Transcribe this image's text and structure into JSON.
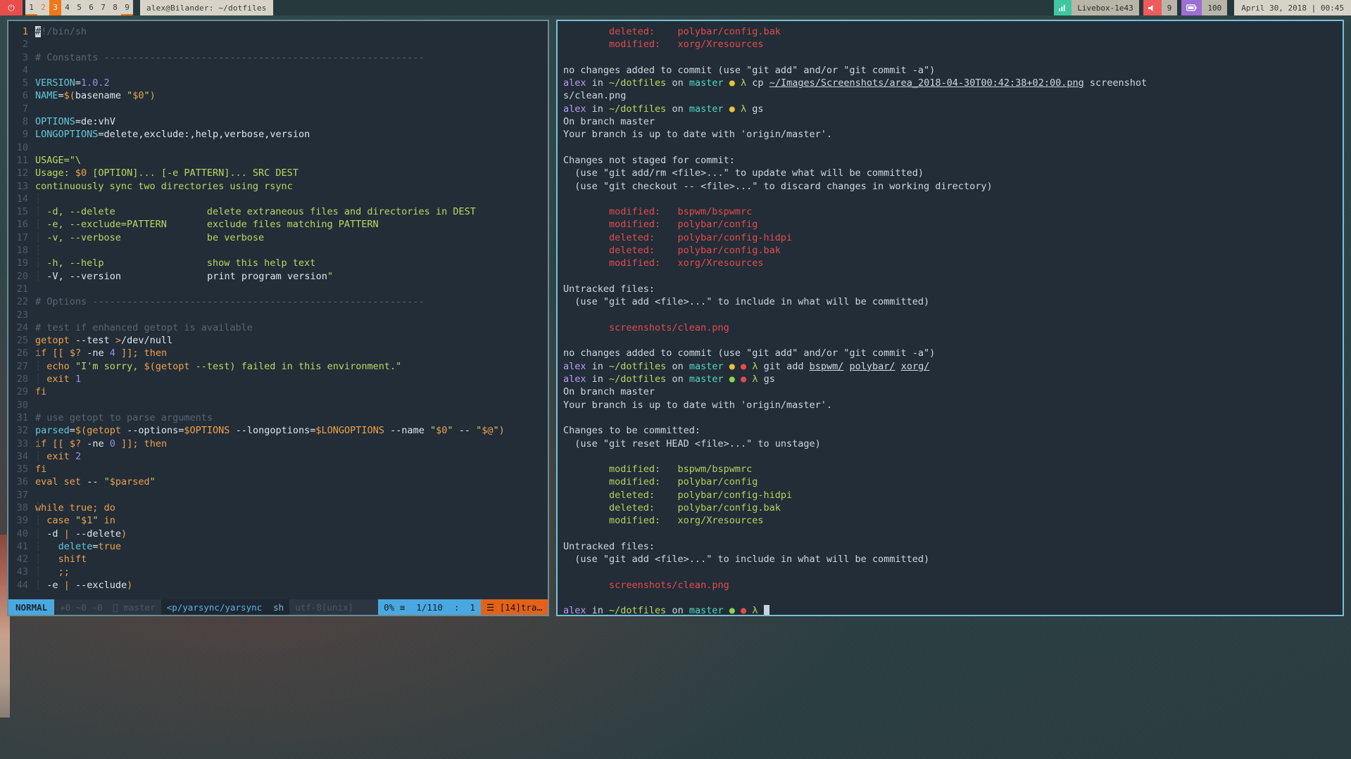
{
  "bar": {
    "power_icon": "⏻",
    "workspaces": [
      {
        "label": "1",
        "state": "occupied-underline"
      },
      {
        "label": "2",
        "state": "occupied"
      },
      {
        "label": "3",
        "state": "focused"
      },
      {
        "label": "4",
        "state": "empty"
      },
      {
        "label": "5",
        "state": "empty"
      },
      {
        "label": "6",
        "state": "empty"
      },
      {
        "label": "7",
        "state": "empty"
      },
      {
        "label": "8",
        "state": "empty"
      },
      {
        "label": "9",
        "state": "occupied-underline"
      }
    ],
    "window_title": "alex@Bilander: ~/dotfiles",
    "modules": [
      {
        "name": "network",
        "icon": "▁▄█",
        "value": "Livebox-1e43",
        "color": "#3ec7a0"
      },
      {
        "name": "volume",
        "icon": "🔊",
        "value": "9",
        "color": "#ef5b5b"
      },
      {
        "name": "battery",
        "icon": "▭",
        "value": "100",
        "color": "#9b6fd4"
      }
    ],
    "datetime": "April 30, 2018 | 00:45"
  },
  "vim": {
    "lines": [
      {
        "n": "1",
        "cur": true
      },
      {
        "n": "2"
      },
      {
        "n": "3"
      },
      {
        "n": "4"
      },
      {
        "n": "5"
      },
      {
        "n": "6"
      },
      {
        "n": "7"
      },
      {
        "n": "8"
      },
      {
        "n": "9"
      },
      {
        "n": "10"
      },
      {
        "n": "11"
      },
      {
        "n": "12"
      },
      {
        "n": "13"
      },
      {
        "n": "14"
      },
      {
        "n": "15"
      },
      {
        "n": "16"
      },
      {
        "n": "17"
      },
      {
        "n": "18"
      },
      {
        "n": "19"
      },
      {
        "n": "20"
      },
      {
        "n": "21"
      },
      {
        "n": "22"
      },
      {
        "n": "23"
      },
      {
        "n": "24"
      },
      {
        "n": "25"
      },
      {
        "n": "26"
      },
      {
        "n": "27"
      },
      {
        "n": "28"
      },
      {
        "n": "29"
      },
      {
        "n": "30"
      },
      {
        "n": "31"
      },
      {
        "n": "32"
      },
      {
        "n": "33"
      },
      {
        "n": "34"
      },
      {
        "n": "35"
      },
      {
        "n": "36"
      },
      {
        "n": "37"
      },
      {
        "n": "38"
      },
      {
        "n": "39"
      },
      {
        "n": "40"
      },
      {
        "n": "41"
      },
      {
        "n": "42"
      },
      {
        "n": "43"
      }
    ],
    "source_text": [
      "#!/bin/sh",
      "",
      "# Constants --------------------------------------------------------",
      "",
      "VERSION=1.0.2",
      "NAME=$(basename \"$0\")",
      "",
      "OPTIONS=de:vhV",
      "LONGOPTIONS=delete,exclude:,help,verbose,version",
      "",
      "USAGE=\"\\",
      "Usage: $0 [OPTION]... [-e PATTERN]... SRC DEST",
      "continuously sync two directories using rsync",
      "",
      "  -d, --delete                delete extraneous files and directories in DEST",
      "  -e, --exclude=PATTERN       exclude files matching PATTERN",
      "  -v, --verbose               be verbose",
      "",
      "  -h, --help                  show this help text",
      "  -V, --version               print program version\"",
      "",
      "# Options ----------------------------------------------------------",
      "",
      "# test if enhanced getopt is available",
      "getopt --test >/dev/null",
      "if [[ $? -ne 4 ]]; then",
      "  echo \"I'm sorry, $(getopt --test) failed in this environment.\"",
      "  exit 1",
      "fi",
      "",
      "# use getopt to parse arguments",
      "parsed=$(getopt --options=$OPTIONS --longoptions=$LONGOPTIONS --name \"$0\" -- \"$@\")",
      "if [[ $? -ne 0 ]]; then",
      "  exit 2",
      "fi",
      "eval set -- \"$parsed\"",
      "",
      "while true; do",
      "  case \"$1\" in",
      "  -d | --delete)",
      "    delete=true",
      "    shift",
      "    ;;",
      "  -e | --exclude)"
    ],
    "status": {
      "mode": "NORMAL",
      "git_added": "+0",
      "git_modified": "~0",
      "git_removed": "-0",
      "branch_icon": "",
      "branch": "master",
      "file": "<p/yarsync/yarsync",
      "filetype": "sh",
      "encoding": "utf-8[unix]",
      "percent": "0%",
      "percent_icon": "≡",
      "line_total": "1/110",
      "line_icon": "",
      "col_sep": ":",
      "col": "1",
      "tag_icon": "☰",
      "tag": "[14]tra…"
    }
  },
  "terminal": {
    "lines": [
      {
        "id": 0,
        "segments": [
          {
            "t": "        deleted:    polybar/config.bak",
            "c": "t-red"
          }
        ]
      },
      {
        "id": 1,
        "segments": [
          {
            "t": "        modified:   xorg/Xresources",
            "c": "t-red"
          }
        ]
      },
      {
        "id": 2,
        "segments": [
          {
            "t": "",
            "c": "t-grey"
          }
        ]
      },
      {
        "id": 3,
        "segments": [
          {
            "t": "no changes added to commit (use \"git add\" and/or \"git commit -a\")",
            "c": "t-grey"
          }
        ]
      },
      {
        "id": 4,
        "segments": [
          {
            "t": "alex",
            "c": "t-user"
          },
          {
            "t": " in ",
            "c": "t-grey"
          },
          {
            "t": "~/dotfiles",
            "c": "t-path"
          },
          {
            "t": " on ",
            "c": "t-grey"
          },
          {
            "t": "master",
            "c": "t-branch"
          },
          {
            "t": " ",
            "c": "t-grey"
          },
          {
            "t": "●",
            "c": "dot-y"
          },
          {
            "t": " ",
            "c": "t-grey"
          },
          {
            "t": "λ",
            "c": "t-lambda"
          },
          {
            "t": " cp ",
            "c": "t-cmd"
          },
          {
            "t": "~/Images/Screenshots/area_2018-04-30T00:42:38+02:00.png",
            "c": "t-grey t-ul"
          },
          {
            "t": " screenshot",
            "c": "t-grey"
          }
        ]
      },
      {
        "id": 5,
        "segments": [
          {
            "t": "s/clean.png",
            "c": "t-grey"
          }
        ]
      },
      {
        "id": 6,
        "segments": [
          {
            "t": "alex",
            "c": "t-user"
          },
          {
            "t": " in ",
            "c": "t-grey"
          },
          {
            "t": "~/dotfiles",
            "c": "t-path"
          },
          {
            "t": " on ",
            "c": "t-grey"
          },
          {
            "t": "master",
            "c": "t-branch"
          },
          {
            "t": " ",
            "c": "t-grey"
          },
          {
            "t": "●",
            "c": "dot-y"
          },
          {
            "t": " ",
            "c": "t-grey"
          },
          {
            "t": "λ",
            "c": "t-lambda"
          },
          {
            "t": " gs",
            "c": "t-cmd"
          }
        ]
      },
      {
        "id": 7,
        "segments": [
          {
            "t": "On branch master",
            "c": "t-grey"
          }
        ]
      },
      {
        "id": 8,
        "segments": [
          {
            "t": "Your branch is up to date with 'origin/master'.",
            "c": "t-grey"
          }
        ]
      },
      {
        "id": 9,
        "segments": [
          {
            "t": "",
            "c": "t-grey"
          }
        ]
      },
      {
        "id": 10,
        "segments": [
          {
            "t": "Changes not staged for commit:",
            "c": "t-grey"
          }
        ]
      },
      {
        "id": 11,
        "segments": [
          {
            "t": "  (use \"git add/rm <file>...\" to update what will be committed)",
            "c": "t-grey"
          }
        ]
      },
      {
        "id": 12,
        "segments": [
          {
            "t": "  (use \"git checkout -- <file>...\" to discard changes in working directory)",
            "c": "t-grey"
          }
        ]
      },
      {
        "id": 13,
        "segments": [
          {
            "t": "",
            "c": "t-grey"
          }
        ]
      },
      {
        "id": 14,
        "segments": [
          {
            "t": "        modified:   bspwm/bspwmrc",
            "c": "t-red"
          }
        ]
      },
      {
        "id": 15,
        "segments": [
          {
            "t": "        modified:   polybar/config",
            "c": "t-red"
          }
        ]
      },
      {
        "id": 16,
        "segments": [
          {
            "t": "        deleted:    polybar/config-hidpi",
            "c": "t-red"
          }
        ]
      },
      {
        "id": 17,
        "segments": [
          {
            "t": "        deleted:    polybar/config.bak",
            "c": "t-red"
          }
        ]
      },
      {
        "id": 18,
        "segments": [
          {
            "t": "        modified:   xorg/Xresources",
            "c": "t-red"
          }
        ]
      },
      {
        "id": 19,
        "segments": [
          {
            "t": "",
            "c": "t-grey"
          }
        ]
      },
      {
        "id": 20,
        "segments": [
          {
            "t": "Untracked files:",
            "c": "t-grey"
          }
        ]
      },
      {
        "id": 21,
        "segments": [
          {
            "t": "  (use \"git add <file>...\" to include in what will be committed)",
            "c": "t-grey"
          }
        ]
      },
      {
        "id": 22,
        "segments": [
          {
            "t": "",
            "c": "t-grey"
          }
        ]
      },
      {
        "id": 23,
        "segments": [
          {
            "t": "        screenshots/clean.png",
            "c": "t-red"
          }
        ]
      },
      {
        "id": 24,
        "segments": [
          {
            "t": "",
            "c": "t-grey"
          }
        ]
      },
      {
        "id": 25,
        "segments": [
          {
            "t": "no changes added to commit (use \"git add\" and/or \"git commit -a\")",
            "c": "t-grey"
          }
        ]
      },
      {
        "id": 26,
        "segments": [
          {
            "t": "alex",
            "c": "t-user"
          },
          {
            "t": " in ",
            "c": "t-grey"
          },
          {
            "t": "~/dotfiles",
            "c": "t-path"
          },
          {
            "t": " on ",
            "c": "t-grey"
          },
          {
            "t": "master",
            "c": "t-branch"
          },
          {
            "t": " ",
            "c": "t-grey"
          },
          {
            "t": "●",
            "c": "dot-y"
          },
          {
            "t": " ",
            "c": "t-grey"
          },
          {
            "t": "●",
            "c": "dot-r"
          },
          {
            "t": " ",
            "c": "t-grey"
          },
          {
            "t": "λ",
            "c": "t-lambda"
          },
          {
            "t": " git add ",
            "c": "t-cmd"
          },
          {
            "t": "bspwm/",
            "c": "t-grey t-ul"
          },
          {
            "t": " ",
            "c": "t-grey"
          },
          {
            "t": "polybar/",
            "c": "t-grey t-ul"
          },
          {
            "t": " ",
            "c": "t-grey"
          },
          {
            "t": "xorg/",
            "c": "t-grey t-ul"
          }
        ]
      },
      {
        "id": 27,
        "segments": [
          {
            "t": "alex",
            "c": "t-user"
          },
          {
            "t": " in ",
            "c": "t-grey"
          },
          {
            "t": "~/dotfiles",
            "c": "t-path"
          },
          {
            "t": " on ",
            "c": "t-grey"
          },
          {
            "t": "master",
            "c": "t-branch"
          },
          {
            "t": " ",
            "c": "t-grey"
          },
          {
            "t": "●",
            "c": "dot-g"
          },
          {
            "t": " ",
            "c": "t-grey"
          },
          {
            "t": "●",
            "c": "dot-r"
          },
          {
            "t": " ",
            "c": "t-grey"
          },
          {
            "t": "λ",
            "c": "t-lambda"
          },
          {
            "t": " gs",
            "c": "t-cmd"
          }
        ]
      },
      {
        "id": 28,
        "segments": [
          {
            "t": "On branch master",
            "c": "t-grey"
          }
        ]
      },
      {
        "id": 29,
        "segments": [
          {
            "t": "Your branch is up to date with 'origin/master'.",
            "c": "t-grey"
          }
        ]
      },
      {
        "id": 30,
        "segments": [
          {
            "t": "",
            "c": "t-grey"
          }
        ]
      },
      {
        "id": 31,
        "segments": [
          {
            "t": "Changes to be committed:",
            "c": "t-grey"
          }
        ]
      },
      {
        "id": 32,
        "segments": [
          {
            "t": "  (use \"git reset HEAD <file>...\" to unstage)",
            "c": "t-grey"
          }
        ]
      },
      {
        "id": 33,
        "segments": [
          {
            "t": "",
            "c": "t-grey"
          }
        ]
      },
      {
        "id": 34,
        "segments": [
          {
            "t": "        modified:   bspwm/bspwmrc",
            "c": "t-green"
          }
        ]
      },
      {
        "id": 35,
        "segments": [
          {
            "t": "        modified:   polybar/config",
            "c": "t-green"
          }
        ]
      },
      {
        "id": 36,
        "segments": [
          {
            "t": "        deleted:    polybar/config-hidpi",
            "c": "t-green"
          }
        ]
      },
      {
        "id": 37,
        "segments": [
          {
            "t": "        deleted:    polybar/config.bak",
            "c": "t-green"
          }
        ]
      },
      {
        "id": 38,
        "segments": [
          {
            "t": "        modified:   xorg/Xresources",
            "c": "t-green"
          }
        ]
      },
      {
        "id": 39,
        "segments": [
          {
            "t": "",
            "c": "t-grey"
          }
        ]
      },
      {
        "id": 40,
        "segments": [
          {
            "t": "Untracked files:",
            "c": "t-grey"
          }
        ]
      },
      {
        "id": 41,
        "segments": [
          {
            "t": "  (use \"git add <file>...\" to include in what will be committed)",
            "c": "t-grey"
          }
        ]
      },
      {
        "id": 42,
        "segments": [
          {
            "t": "",
            "c": "t-grey"
          }
        ]
      },
      {
        "id": 43,
        "segments": [
          {
            "t": "        screenshots/clean.png",
            "c": "t-red"
          }
        ]
      },
      {
        "id": 44,
        "segments": [
          {
            "t": "",
            "c": "t-grey"
          }
        ]
      },
      {
        "id": 45,
        "segments": [
          {
            "t": "alex",
            "c": "t-user"
          },
          {
            "t": " in ",
            "c": "t-grey"
          },
          {
            "t": "~/dotfiles",
            "c": "t-path"
          },
          {
            "t": " on ",
            "c": "t-grey"
          },
          {
            "t": "master",
            "c": "t-branch"
          },
          {
            "t": " ",
            "c": "t-grey"
          },
          {
            "t": "●",
            "c": "dot-g"
          },
          {
            "t": " ",
            "c": "t-grey"
          },
          {
            "t": "●",
            "c": "dot-r"
          },
          {
            "t": " ",
            "c": "t-grey"
          },
          {
            "t": "λ",
            "c": "t-lambda"
          },
          {
            "t": " ",
            "c": "t-grey"
          },
          {
            "t": " ",
            "c": "t-cursor"
          }
        ]
      }
    ]
  },
  "colors": {
    "bg_window": "#222d38",
    "bar_bg": "#25383c",
    "accent_orange": "#f07818",
    "accent_blue": "#4aa8e0",
    "border_focus": "#79c0d8",
    "border_unfocus": "#6b8b93",
    "git_red": "#e54b4b",
    "git_green": "#b4d45c"
  }
}
